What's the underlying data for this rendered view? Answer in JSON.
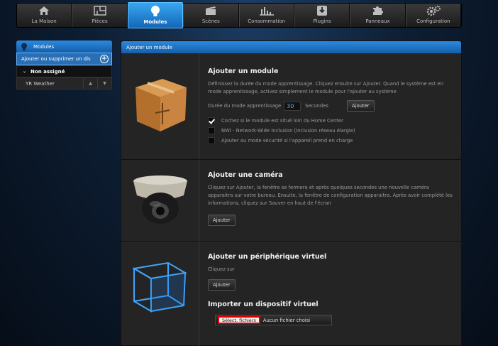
{
  "nav": [
    {
      "label": "La Maison",
      "icon": "house-icon",
      "active": false
    },
    {
      "label": "Pièces",
      "icon": "rooms-icon",
      "active": false
    },
    {
      "label": "Modules",
      "icon": "lightbulb-icon",
      "active": true
    },
    {
      "label": "Scènes",
      "icon": "clapperboard-icon",
      "active": false
    },
    {
      "label": "Consommation",
      "icon": "bar-chart-icon",
      "active": false
    },
    {
      "label": "Plugins",
      "icon": "download-icon",
      "active": false
    },
    {
      "label": "Panneaux",
      "icon": "puzzle-icon",
      "active": false
    },
    {
      "label": "Configuration",
      "icon": "gears-icon",
      "active": false
    }
  ],
  "sidebar": {
    "title": "Modules",
    "add_label": "Ajouter ou supprimer un dis",
    "room_label": "Non assigné",
    "device_label": "YR Weather"
  },
  "main": {
    "header": "Ajouter un module",
    "module": {
      "title": "Ajouter un module",
      "description": "Définissez la durée du mode apprentissage. Cliquez ensuite sur Ajouter. Quand le système est en mode apprentissage, activez simplement le module pour l'ajouter au système",
      "duration_label": "Durée du mode apprentissage",
      "duration_value": "30",
      "duration_unit": "Secondes",
      "add_button": "Ajouter",
      "options": [
        {
          "label": "Cochez si le module est situé loin du Home Center",
          "checked": true
        },
        {
          "label": "NWI - Network-Wide Inclusion (Inclusion réseau élargie)",
          "checked": false
        },
        {
          "label": "Ajouter au mode sécurité si l'appareil prend en charge",
          "checked": false
        }
      ]
    },
    "camera": {
      "title": "Ajouter une caméra",
      "description": "Cliquez sur Ajouter, la fenêtre se fermera et après quelques secondes une nouvelle caméra apparaitra sur votre bureau. Ensuite, la fenêtre de configuration apparaitra. Après avoir complété les informations, cliquez sur Sauver en haut de l'écran",
      "add_button": "Ajouter"
    },
    "virtual": {
      "title": "Ajouter un périphérique virtuel",
      "description": "Cliquez sur",
      "add_button": "Ajouter",
      "import_title": "Importer un dispositif virtuel",
      "file_button": "Sélect. fichiers",
      "file_status": "Aucun fichier choisi"
    }
  }
}
